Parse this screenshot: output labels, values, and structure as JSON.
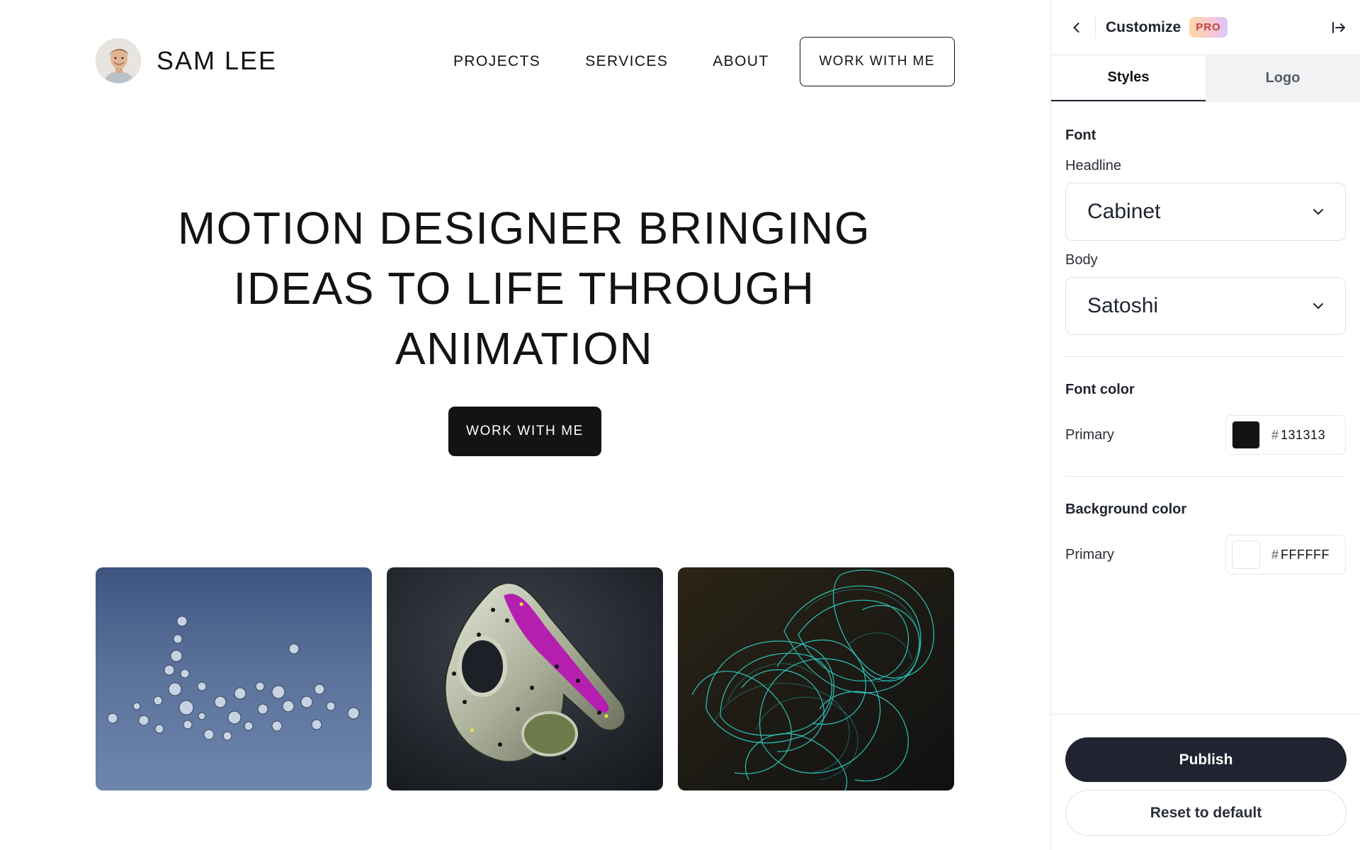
{
  "site": {
    "brand_name": "SAM LEE",
    "nav": {
      "projects": "PROJECTS",
      "services": "SERVICES",
      "about": "ABOUT",
      "cta": "WORK WITH ME"
    },
    "hero": {
      "title": "MOTION DESIGNER BRINGING IDEAS TO LIFE THROUGH ANIMATION",
      "cta": "WORK WITH ME"
    }
  },
  "panel": {
    "title": "Customize",
    "badge": "PRO",
    "tabs": {
      "styles": "Styles",
      "logo": "Logo"
    },
    "font": {
      "section_title": "Font",
      "headline_label": "Headline",
      "headline_value": "Cabinet",
      "body_label": "Body",
      "body_value": "Satoshi"
    },
    "font_color": {
      "section_title": "Font color",
      "primary_label": "Primary",
      "hash": "#",
      "hex": "131313",
      "swatch_color": "#131313"
    },
    "background_color": {
      "section_title": "Background color",
      "primary_label": "Primary",
      "hash": "#",
      "hex": "FFFFFF",
      "swatch_color": "#FFFFFF"
    },
    "footer": {
      "publish": "Publish",
      "reset": "Reset to default"
    }
  }
}
